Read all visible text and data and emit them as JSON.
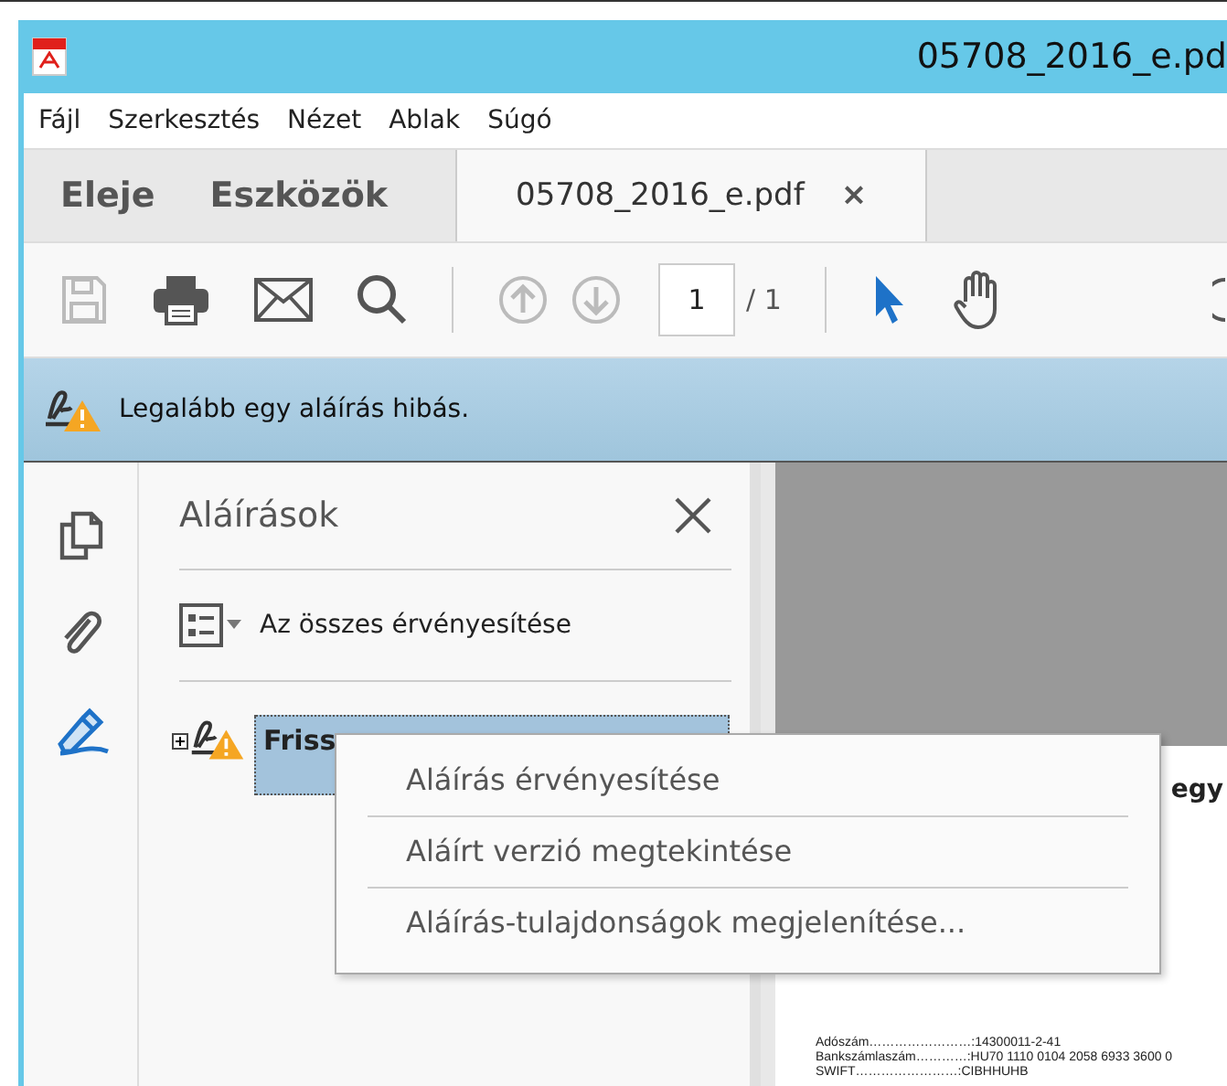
{
  "window": {
    "title": "05708_2016_e.pd"
  },
  "menu": [
    "Fájl",
    "Szerkesztés",
    "Nézet",
    "Ablak",
    "Súgó"
  ],
  "nav_tabs": [
    {
      "label": "Eleje",
      "selected": false
    },
    {
      "label": "Eszközök",
      "selected": false
    }
  ],
  "doc_tab": {
    "label": "05708_2016_e.pdf",
    "selected": true,
    "close": "×"
  },
  "toolbar": {
    "page": "1",
    "page_total": "/ 1"
  },
  "notification": {
    "text": "Legalább egy aláírás hibás."
  },
  "panel": {
    "title": "Aláírások",
    "validate_all": "Az összes érvényesítése",
    "signatures": [
      {
        "label": "Friss",
        "selected": true,
        "expanded": false
      }
    ]
  },
  "document": {
    "lines": [
      "egy",
      "Adószám……………………:14300011-2-41",
      "Bankszámlaszám…………:HU70 1110 0104 2058 6933 3600 0",
      "SWIFT……………………:CIBHHUHB"
    ]
  },
  "context_menu": [
    "Aláírás érvényesítése",
    "Aláírt verzió megtekintése",
    "Aláírás-tulajdonságok megjelenítése..."
  ]
}
